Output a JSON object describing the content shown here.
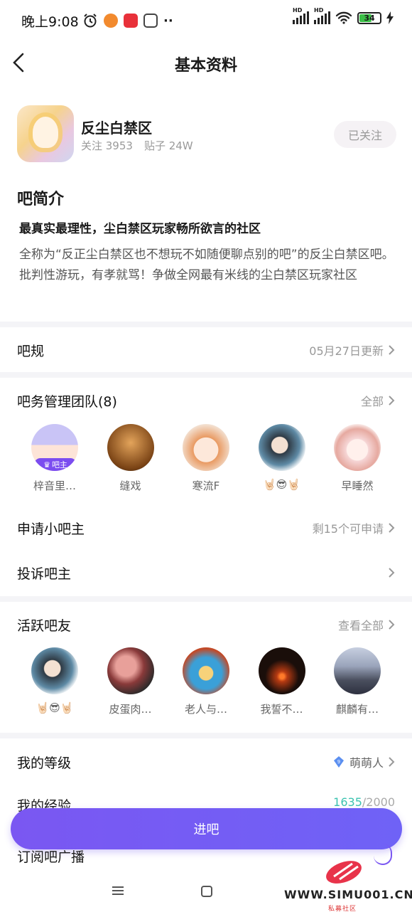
{
  "status_bar": {
    "time": "晚上9:08",
    "battery": "34"
  },
  "nav": {
    "title": "基本资料"
  },
  "forum": {
    "name": "反尘白禁区",
    "followers": "关注 3953",
    "posts": "贴子 24W",
    "follow_label": "已关注"
  },
  "intro": {
    "title": "吧简介",
    "slogan": "最真实最理性，尘白禁区玩家畅所欲言的社区",
    "description": "全称为“反正尘白禁区也不想玩不如随便聊点别的吧”的反尘白禁区吧。批判性游玩，有孝就骂！争做全网最有米线的尘白禁区玩家社区"
  },
  "rules": {
    "label": "吧规",
    "right": "05月27日更新"
  },
  "team": {
    "label": "吧务管理团队(8)",
    "right": "全部",
    "owner_badge": "吧主",
    "members": [
      {
        "name": "梓音里…",
        "color": "#c9c4f6"
      },
      {
        "name": "缝戏",
        "color": "#c77b34"
      },
      {
        "name": "寒流F",
        "color": "#f2c6a0"
      },
      {
        "name": "🤘🏻😎🤘🏻",
        "color": "#5e8aa5"
      },
      {
        "name": "早睡然",
        "color": "#f6d6d6"
      }
    ]
  },
  "apply": {
    "label": "申请小吧主",
    "right": "剩15个可申请"
  },
  "complain": {
    "label": "投诉吧主"
  },
  "active": {
    "label": "活跃吧友",
    "right": "查看全部",
    "members": [
      {
        "name": "🤘🏻😎🤘🏻",
        "color": "#5e8aa5"
      },
      {
        "name": "皮蛋肉…",
        "color": "#8a3a3a"
      },
      {
        "name": "老人与…",
        "color": "#c24a28"
      },
      {
        "name": "我誓不…",
        "color": "#1a0e0a"
      },
      {
        "name": "麒麟有…",
        "color": "#6a7690"
      }
    ]
  },
  "level": {
    "label": "我的等级",
    "right": "萌萌人",
    "badge_num": "9"
  },
  "exp": {
    "label": "我的经验",
    "current": "1635",
    "total": "/2000"
  },
  "enter_button": "进吧",
  "subscribe": {
    "label": "订阅吧广播"
  },
  "watermark": {
    "text": "WWW.SIMU001.CN",
    "sub": "私募社区"
  },
  "colors": {
    "accent": "#7a57f2",
    "muted": "#999999",
    "divider": "#f4f4f7"
  }
}
